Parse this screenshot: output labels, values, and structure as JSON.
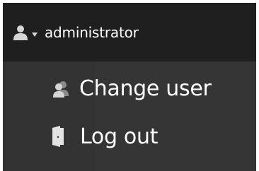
{
  "header": {
    "user_icon": "user-icon",
    "caret_icon": "caret-down-icon",
    "username": "administrator"
  },
  "menu": {
    "items": [
      {
        "icon": "change-user-icon",
        "label": "Change user"
      },
      {
        "icon": "logout-door-icon",
        "label": "Log out"
      }
    ]
  },
  "colors": {
    "header_background": "#1f1f1f",
    "menu_background": "#333333",
    "text": "#ffffff",
    "icon": "#d6d6d6"
  }
}
